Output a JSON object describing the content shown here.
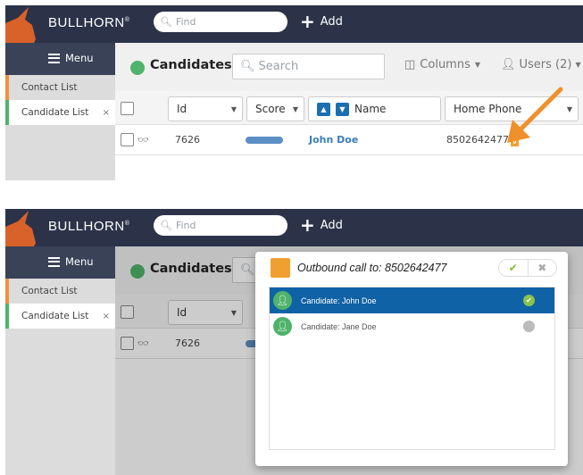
{
  "panels": [
    {
      "app": {
        "brand": "BULLHORN",
        "brand_mark": "®",
        "find_placeholder": "Find",
        "add_label": "Add",
        "menu_label": "Menu"
      },
      "sidebar": {
        "items": [
          {
            "label": "Contact List",
            "accent": "#f0903e"
          },
          {
            "label": "Candidate List",
            "accent": "#4fb36b",
            "close": "×"
          }
        ]
      },
      "main": {
        "title": "Candidates",
        "status_color": "#4fb36b",
        "search_placeholder": "Search",
        "columns_label": "Columns",
        "users_label": "Users (2)"
      },
      "table": {
        "columns": [
          "Id",
          "Score",
          "Name",
          "Home Phone"
        ],
        "rows": [
          {
            "id": "7626",
            "name": "John Doe",
            "home_phone": "8502642477",
            "badge": "V"
          }
        ]
      }
    },
    {
      "app": {
        "brand": "BULLHORN",
        "brand_mark": "®",
        "find_placeholder": "Find",
        "add_label": "Add",
        "menu_label": "Menu"
      },
      "sidebar": {
        "items": [
          {
            "label": "Contact List"
          },
          {
            "label": "Candidate List",
            "close": "×"
          }
        ]
      },
      "main": {
        "title": "Candidates",
        "columns": [
          "Id"
        ],
        "rows": [
          {
            "id": "7626"
          }
        ]
      },
      "modal": {
        "title": "Outbound call to: 8502642477",
        "confirm_icon": "check-icon",
        "cancel_icon": "close-icon",
        "options": [
          {
            "label": "Candidate: John Doe",
            "selected": true
          },
          {
            "label": "Candidate: Jane Doe",
            "selected": false
          }
        ]
      }
    }
  ],
  "colors": {
    "topbar": "#2c3349",
    "accent_blue": "#0f62a6",
    "link_blue": "#3b7cb8",
    "arrow_orange": "#f0902a"
  }
}
